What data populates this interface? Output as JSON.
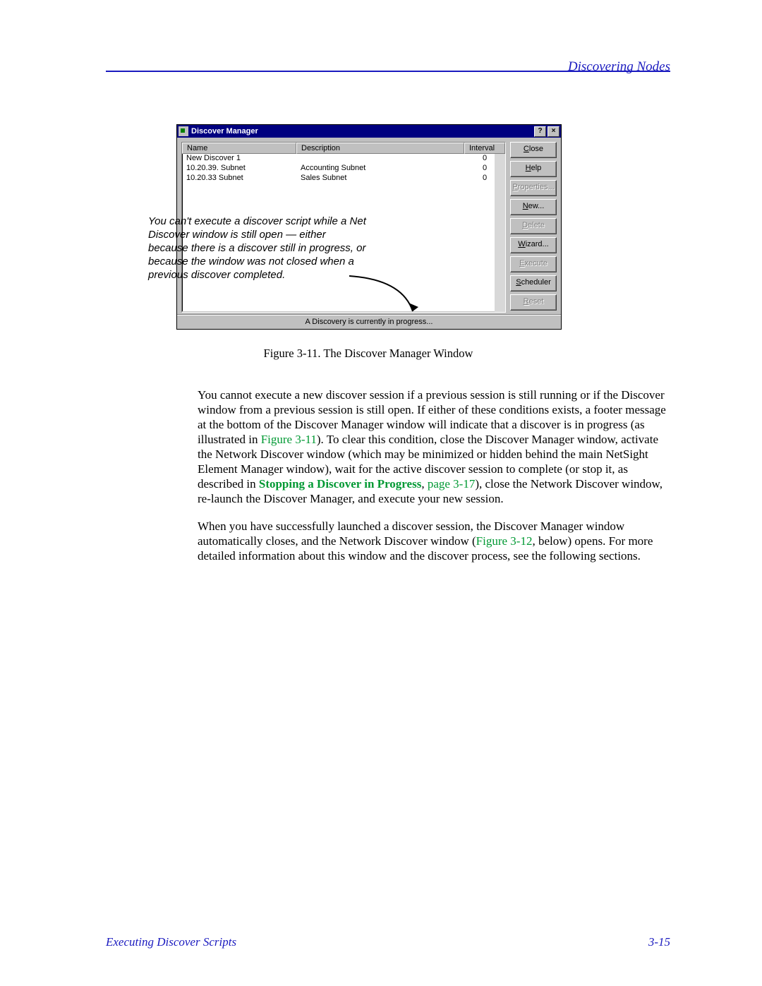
{
  "header": {
    "title": "Discovering Nodes"
  },
  "window": {
    "title": "Discover Manager",
    "help_btn": "?",
    "close_btn": "×",
    "columns": {
      "name": "Name",
      "description": "Description",
      "interval": "Interval"
    },
    "rows": [
      {
        "name": "New Discover 1",
        "description": "",
        "interval": "0"
      },
      {
        "name": "10.20.39. Subnet",
        "description": "Accounting Subnet",
        "interval": "0"
      },
      {
        "name": "10.20.33 Subnet",
        "description": "Sales Subnet",
        "interval": "0"
      }
    ],
    "buttons": {
      "close": {
        "pre": "",
        "u": "C",
        "post": "lose",
        "disabled": false
      },
      "help": {
        "pre": "",
        "u": "H",
        "post": "elp",
        "disabled": false
      },
      "properties": {
        "pre": "",
        "u": "P",
        "post": "roperties...",
        "disabled": true
      },
      "new": {
        "pre": "",
        "u": "N",
        "post": "ew...",
        "disabled": false
      },
      "delete": {
        "pre": "",
        "u": "D",
        "post": "elete",
        "disabled": true
      },
      "wizard": {
        "pre": "",
        "u": "W",
        "post": "izard...",
        "disabled": false
      },
      "execute": {
        "pre": "",
        "u": "E",
        "post": "xecute",
        "disabled": true
      },
      "scheduler": {
        "pre": "",
        "u": "S",
        "post": "cheduler",
        "disabled": false
      },
      "reset": {
        "pre": "",
        "u": "R",
        "post": "eset",
        "disabled": true
      }
    },
    "status": "A Discovery is currently in progress..."
  },
  "annotation": "You can't execute a discover script while a Net Discover window is still open — either because there is a discover still in progress, or because the window was not closed when a previous discover completed.",
  "caption": "Figure 3-11.  The Discover Manager Window",
  "body": {
    "p1a": "You cannot execute a new discover session if a previous session is still running or if the Discover window from a previous session is still open. If either of these conditions exists, a footer message at the bottom of the Discover Manager window will indicate that a discover is in progress (as illustrated in ",
    "p1link1": "Figure 3-11",
    "p1b": "). To clear this condition, close the Discover Manager window, activate the Network Discover window (which may be minimized or hidden behind the main NetSight Element Manager window), wait for the active discover session to complete (or stop it, as described in ",
    "p1link2": "Stopping a Discover in Progress",
    "p1c": ", ",
    "p1link3": "page 3-17",
    "p1d": "), close the Network Discover window, re-launch the Discover Manager, and execute your new session.",
    "p2a": "When you have successfully launched a discover session, the Discover Manager window automatically closes, and the Network Discover window (",
    "p2link": "Figure 3-12",
    "p2b": ", below) opens. For more detailed information about this window and the discover process, see the following sections."
  },
  "footer": {
    "left": "Executing Discover Scripts",
    "right": "3-15"
  }
}
